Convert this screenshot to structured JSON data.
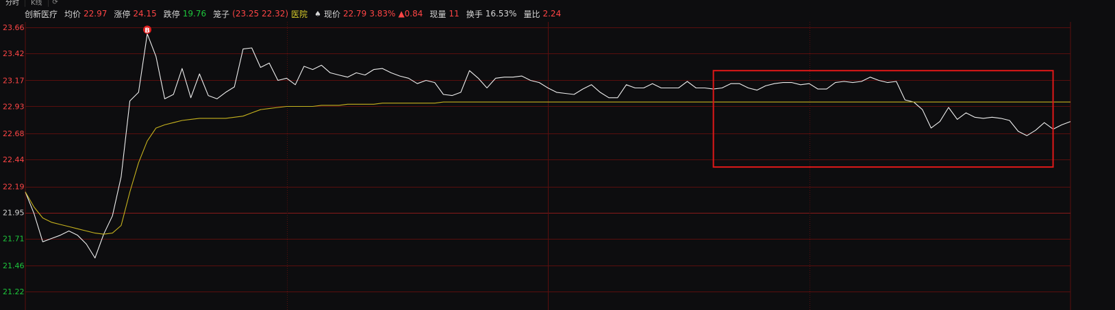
{
  "tabs": [
    {
      "label": "分时",
      "active": true
    },
    {
      "label": "K线",
      "active": false
    }
  ],
  "tab_icon": "refresh-icon",
  "info_bar": {
    "name": "创新医疗",
    "avg_label": "均价",
    "avg_value": "22.97",
    "limit_up_label": "涨停",
    "limit_up_value": "24.15",
    "limit_down_label": "跌停",
    "limit_down_value": "19.76",
    "cage_label": "笼子",
    "cage_value": "(23.25 22.32)",
    "sector": "医院",
    "current_label": "现价",
    "current_value": "22.79",
    "change_pct": "3.83%",
    "change_abs": "▲0.84",
    "volume_label": "现量",
    "volume_value": "11",
    "turnover_label": "换手",
    "turnover_value": "16.53%",
    "ratio_label": "量比",
    "ratio_value": "2.24",
    "colors": {
      "up": "#ff4545",
      "down": "#1ec83c",
      "sector": "#d7cc2a",
      "text": "#d6d6d6"
    }
  },
  "chart_data": {
    "type": "line",
    "y_ticks": [
      "23.66",
      "23.42",
      "23.17",
      "22.93",
      "22.68",
      "22.44",
      "22.19",
      "21.95",
      "21.71",
      "21.46",
      "21.22"
    ],
    "prev_close": 21.95,
    "ylim": [
      21.05,
      23.71
    ],
    "x_points": 121,
    "grid": true,
    "colors": {
      "price": "#f0f0f0",
      "avg": "#c8b41e",
      "grid": "#5a0e0e",
      "up": "#ff4545",
      "down": "#1ec83c",
      "highlight": "#e01818"
    },
    "marker": {
      "label": "B",
      "index": 14,
      "value": 23.6
    },
    "highlight_box": {
      "start_index": 79,
      "end_index": 118,
      "y_top": 23.26,
      "y_bottom": 22.37
    },
    "series": [
      {
        "values": [
          22.14,
          21.94,
          21.68,
          21.71,
          21.74,
          21.78,
          21.74,
          21.66,
          21.53,
          21.75,
          21.92,
          22.28,
          22.98,
          23.06,
          23.6,
          23.39,
          23.0,
          23.04,
          23.28,
          23.01,
          23.23,
          23.03,
          23.0,
          23.06,
          23.11,
          23.46,
          23.47,
          23.29,
          23.33,
          23.17,
          23.19,
          23.13,
          23.3,
          23.27,
          23.31,
          23.24,
          23.22,
          23.2,
          23.24,
          23.22,
          23.27,
          23.28,
          23.24,
          23.21,
          23.19,
          23.14,
          23.17,
          23.15,
          23.04,
          23.03,
          23.06,
          23.26,
          23.19,
          23.1,
          23.19,
          23.2,
          23.2,
          23.21,
          23.17,
          23.15,
          23.1,
          23.06,
          23.05,
          23.04,
          23.09,
          23.13,
          23.06,
          23.01,
          23.01,
          23.13,
          23.1,
          23.1,
          23.14,
          23.1,
          23.1,
          23.1,
          23.16,
          23.1,
          23.1,
          23.09,
          23.1,
          23.14,
          23.14,
          23.1,
          23.08,
          23.12,
          23.14,
          23.15,
          23.15,
          23.13,
          23.14,
          23.09,
          23.09,
          23.15,
          23.16,
          23.15,
          23.16,
          23.2,
          23.17,
          23.15,
          23.16,
          22.99,
          22.97,
          22.9,
          22.73,
          22.79,
          22.92,
          22.81,
          22.87,
          22.83,
          22.82,
          22.83,
          22.82,
          22.8,
          22.7,
          22.66,
          22.71,
          22.78,
          22.72,
          22.76,
          22.79
        ]
      },
      {
        "values": [
          22.14,
          22.0,
          21.9,
          21.86,
          21.84,
          21.82,
          21.8,
          21.78,
          21.76,
          21.75,
          21.76,
          21.83,
          22.14,
          22.41,
          22.61,
          22.73,
          22.76,
          22.78,
          22.8,
          22.81,
          22.82,
          22.82,
          22.82,
          22.82,
          22.83,
          22.84,
          22.87,
          22.9,
          22.91,
          22.92,
          22.93,
          22.93,
          22.93,
          22.93,
          22.94,
          22.94,
          22.94,
          22.95,
          22.95,
          22.95,
          22.95,
          22.96,
          22.96,
          22.96,
          22.96,
          22.96,
          22.96,
          22.96,
          22.97,
          22.97,
          22.97,
          22.97,
          22.97,
          22.97,
          22.97,
          22.97,
          22.97,
          22.97,
          22.97,
          22.97,
          22.97,
          22.97,
          22.97,
          22.97,
          22.97,
          22.97,
          22.97,
          22.97,
          22.97,
          22.97,
          22.97,
          22.97,
          22.97,
          22.97,
          22.97,
          22.97,
          22.97,
          22.97,
          22.97,
          22.97,
          22.97,
          22.97,
          22.97,
          22.97,
          22.97,
          22.97,
          22.97,
          22.97,
          22.97,
          22.97,
          22.97,
          22.97,
          22.97,
          22.97,
          22.97,
          22.97,
          22.97,
          22.97,
          22.97,
          22.97,
          22.97,
          22.97,
          22.97,
          22.97,
          22.97,
          22.97,
          22.97,
          22.97,
          22.97,
          22.97,
          22.97,
          22.97,
          22.97,
          22.97,
          22.97,
          22.97,
          22.97,
          22.97,
          22.97,
          22.97,
          22.97
        ]
      }
    ]
  }
}
